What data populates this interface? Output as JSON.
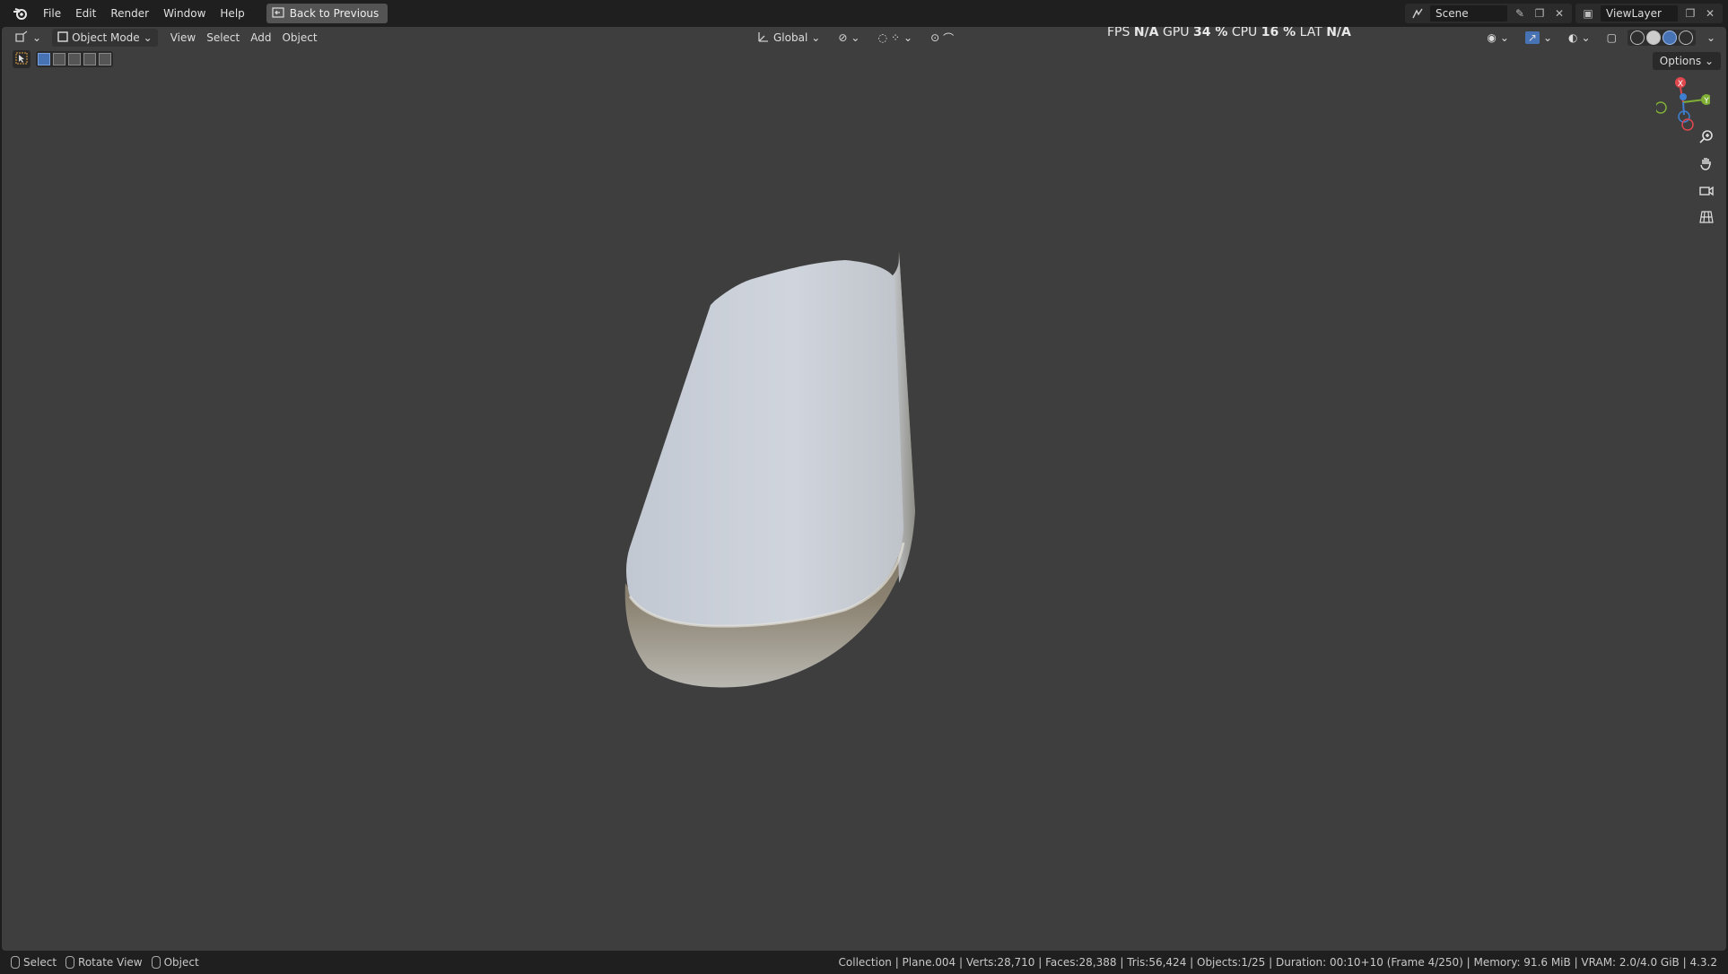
{
  "topbar": {
    "menus": [
      "File",
      "Edit",
      "Render",
      "Window",
      "Help"
    ],
    "back_label": "Back to Previous",
    "scene": "Scene",
    "view_layer": "ViewLayer"
  },
  "viewport_header": {
    "mode": "Object Mode",
    "menus": [
      "View",
      "Select",
      "Add",
      "Object"
    ],
    "orientation": "Global",
    "options": "Options"
  },
  "stats": {
    "fps_label": "FPS",
    "fps": "N/A",
    "gpu_label": "GPU",
    "gpu": "34 %",
    "cpu_label": "CPU",
    "cpu": "16 %",
    "lat_label": "LAT",
    "lat": "N/A"
  },
  "gizmo": {
    "x": "X",
    "y": "Y"
  },
  "status": {
    "hints": [
      "Select",
      "Rotate View",
      "Object"
    ],
    "info": "Collection | Plane.004 | Verts:28,710 | Faces:28,388 | Tris:56,424 | Objects:1/25 | Duration: 00:10+10 (Frame 4/250) | Memory: 91.6 MiB | VRAM: 2.0/4.0 GiB | 4.3.2"
  },
  "colors": {
    "viewport_bg": "#3e3e3e",
    "bar_bg": "#1f1f1f",
    "accent_blue": "#4772b3",
    "axis_x": "#e0474f",
    "axis_y": "#7fb035",
    "axis_z": "#3f7fd2"
  }
}
